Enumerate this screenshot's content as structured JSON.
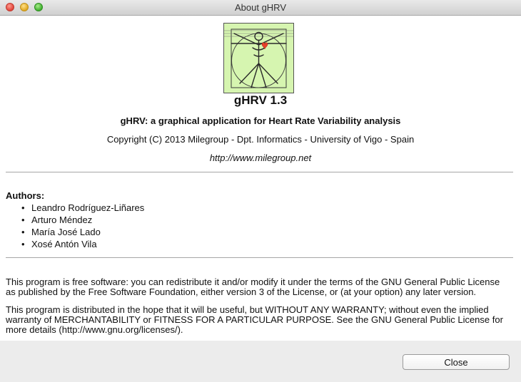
{
  "window": {
    "title": "About gHRV"
  },
  "about": {
    "app_name": "gHRV 1.3",
    "subtitle": "gHRV: a graphical application for Heart Rate Variability analysis",
    "copyright": "Copyright (C) 2013 Milegroup - Dpt. Informatics - University of Vigo - Spain",
    "website": "http://www.milegroup.net",
    "authors_heading": "Authors:",
    "authors": [
      "Leandro Rodríguez-Liñares",
      "Arturo Méndez",
      "María José Lado",
      "Xosé Antón Vila"
    ],
    "license_para_1_line_1": "This program is free software: you can redistribute it and/or modify it under the terms of the GNU General Public License",
    "license_para_1_line_2": "as published by the Free Software Foundation, either version 3 of the License, or (at your option) any later version.",
    "license_para_2_line_1": "This program is distributed in the hope that it will be useful, but WITHOUT ANY WARRANTY; without even the implied",
    "license_para_2_line_2": "warranty of MERCHANTABILITY or FITNESS FOR A PARTICULAR PURPOSE. See the GNU General Public License for",
    "license_para_2_line_3": "more details (http://www.gnu.org/licenses/)."
  },
  "footer": {
    "close_label": "Close"
  },
  "colors": {
    "logo_background": "#d6f5b0",
    "heart": "#e8402a"
  },
  "icons": {
    "logo": "vitruvian-man-icon"
  }
}
